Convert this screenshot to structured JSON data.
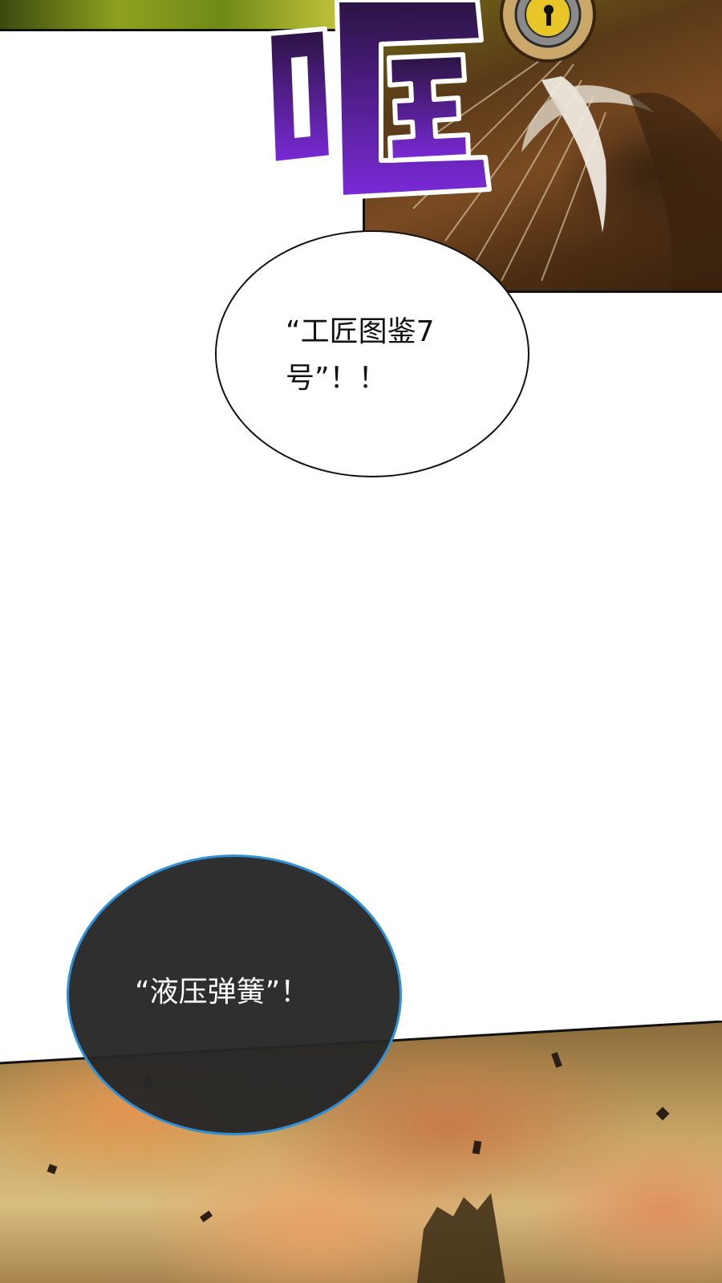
{
  "panels": {
    "top_left": {},
    "top_right": {
      "sfx_text": "哐"
    },
    "bottom": {}
  },
  "bubbles": {
    "white": {
      "line1": "“工匠图鉴7",
      "line2": "号”！！"
    },
    "dark": {
      "text": "“液压弹簧”！"
    }
  },
  "colors": {
    "sfx_top": "#2a1440",
    "sfx_bottom": "#7a2ad8",
    "dark_bubble_border": "#2f8fd8",
    "dark_bubble_fill": "#262626"
  }
}
